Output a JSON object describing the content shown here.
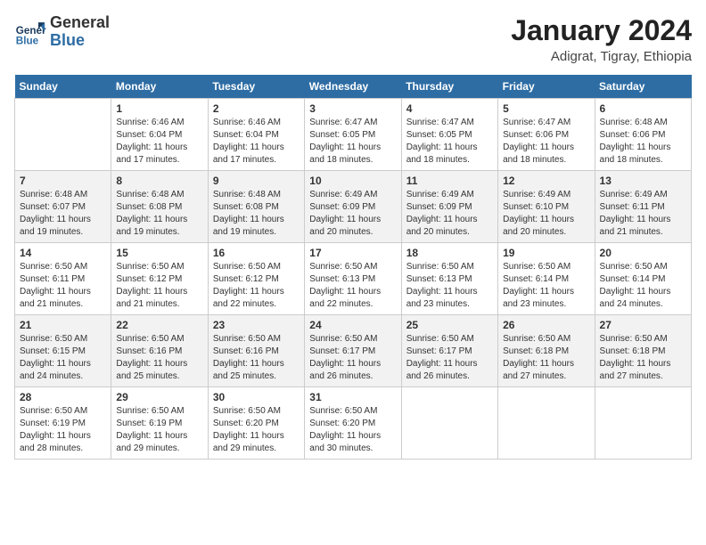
{
  "header": {
    "logo_line1": "General",
    "logo_line2": "Blue",
    "month_year": "January 2024",
    "location": "Adigrat, Tigray, Ethiopia"
  },
  "weekdays": [
    "Sunday",
    "Monday",
    "Tuesday",
    "Wednesday",
    "Thursday",
    "Friday",
    "Saturday"
  ],
  "weeks": [
    [
      {
        "day": "",
        "info": ""
      },
      {
        "day": "1",
        "info": "Sunrise: 6:46 AM\nSunset: 6:04 PM\nDaylight: 11 hours\nand 17 minutes."
      },
      {
        "day": "2",
        "info": "Sunrise: 6:46 AM\nSunset: 6:04 PM\nDaylight: 11 hours\nand 17 minutes."
      },
      {
        "day": "3",
        "info": "Sunrise: 6:47 AM\nSunset: 6:05 PM\nDaylight: 11 hours\nand 18 minutes."
      },
      {
        "day": "4",
        "info": "Sunrise: 6:47 AM\nSunset: 6:05 PM\nDaylight: 11 hours\nand 18 minutes."
      },
      {
        "day": "5",
        "info": "Sunrise: 6:47 AM\nSunset: 6:06 PM\nDaylight: 11 hours\nand 18 minutes."
      },
      {
        "day": "6",
        "info": "Sunrise: 6:48 AM\nSunset: 6:06 PM\nDaylight: 11 hours\nand 18 minutes."
      }
    ],
    [
      {
        "day": "7",
        "info": "Sunrise: 6:48 AM\nSunset: 6:07 PM\nDaylight: 11 hours\nand 19 minutes."
      },
      {
        "day": "8",
        "info": "Sunrise: 6:48 AM\nSunset: 6:08 PM\nDaylight: 11 hours\nand 19 minutes."
      },
      {
        "day": "9",
        "info": "Sunrise: 6:48 AM\nSunset: 6:08 PM\nDaylight: 11 hours\nand 19 minutes."
      },
      {
        "day": "10",
        "info": "Sunrise: 6:49 AM\nSunset: 6:09 PM\nDaylight: 11 hours\nand 20 minutes."
      },
      {
        "day": "11",
        "info": "Sunrise: 6:49 AM\nSunset: 6:09 PM\nDaylight: 11 hours\nand 20 minutes."
      },
      {
        "day": "12",
        "info": "Sunrise: 6:49 AM\nSunset: 6:10 PM\nDaylight: 11 hours\nand 20 minutes."
      },
      {
        "day": "13",
        "info": "Sunrise: 6:49 AM\nSunset: 6:11 PM\nDaylight: 11 hours\nand 21 minutes."
      }
    ],
    [
      {
        "day": "14",
        "info": "Sunrise: 6:50 AM\nSunset: 6:11 PM\nDaylight: 11 hours\nand 21 minutes."
      },
      {
        "day": "15",
        "info": "Sunrise: 6:50 AM\nSunset: 6:12 PM\nDaylight: 11 hours\nand 21 minutes."
      },
      {
        "day": "16",
        "info": "Sunrise: 6:50 AM\nSunset: 6:12 PM\nDaylight: 11 hours\nand 22 minutes."
      },
      {
        "day": "17",
        "info": "Sunrise: 6:50 AM\nSunset: 6:13 PM\nDaylight: 11 hours\nand 22 minutes."
      },
      {
        "day": "18",
        "info": "Sunrise: 6:50 AM\nSunset: 6:13 PM\nDaylight: 11 hours\nand 23 minutes."
      },
      {
        "day": "19",
        "info": "Sunrise: 6:50 AM\nSunset: 6:14 PM\nDaylight: 11 hours\nand 23 minutes."
      },
      {
        "day": "20",
        "info": "Sunrise: 6:50 AM\nSunset: 6:14 PM\nDaylight: 11 hours\nand 24 minutes."
      }
    ],
    [
      {
        "day": "21",
        "info": "Sunrise: 6:50 AM\nSunset: 6:15 PM\nDaylight: 11 hours\nand 24 minutes."
      },
      {
        "day": "22",
        "info": "Sunrise: 6:50 AM\nSunset: 6:16 PM\nDaylight: 11 hours\nand 25 minutes."
      },
      {
        "day": "23",
        "info": "Sunrise: 6:50 AM\nSunset: 6:16 PM\nDaylight: 11 hours\nand 25 minutes."
      },
      {
        "day": "24",
        "info": "Sunrise: 6:50 AM\nSunset: 6:17 PM\nDaylight: 11 hours\nand 26 minutes."
      },
      {
        "day": "25",
        "info": "Sunrise: 6:50 AM\nSunset: 6:17 PM\nDaylight: 11 hours\nand 26 minutes."
      },
      {
        "day": "26",
        "info": "Sunrise: 6:50 AM\nSunset: 6:18 PM\nDaylight: 11 hours\nand 27 minutes."
      },
      {
        "day": "27",
        "info": "Sunrise: 6:50 AM\nSunset: 6:18 PM\nDaylight: 11 hours\nand 27 minutes."
      }
    ],
    [
      {
        "day": "28",
        "info": "Sunrise: 6:50 AM\nSunset: 6:19 PM\nDaylight: 11 hours\nand 28 minutes."
      },
      {
        "day": "29",
        "info": "Sunrise: 6:50 AM\nSunset: 6:19 PM\nDaylight: 11 hours\nand 29 minutes."
      },
      {
        "day": "30",
        "info": "Sunrise: 6:50 AM\nSunset: 6:20 PM\nDaylight: 11 hours\nand 29 minutes."
      },
      {
        "day": "31",
        "info": "Sunrise: 6:50 AM\nSunset: 6:20 PM\nDaylight: 11 hours\nand 30 minutes."
      },
      {
        "day": "",
        "info": ""
      },
      {
        "day": "",
        "info": ""
      },
      {
        "day": "",
        "info": ""
      }
    ]
  ]
}
